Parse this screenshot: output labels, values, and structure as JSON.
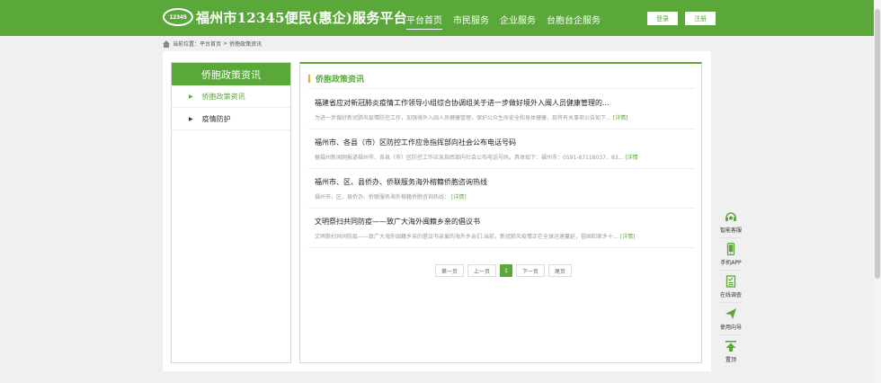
{
  "header": {
    "logo_text": "12345",
    "site_title": "福州市12345便民(惠企)服务平台",
    "nav": [
      "平台首页",
      "市民服务",
      "企业服务",
      "台胞台企服务"
    ],
    "login_label": "登录",
    "register_label": "注册"
  },
  "breadcrumb": {
    "prefix": "当前位置：",
    "home": "平台首页",
    "separator": ">",
    "current": "侨胞政策资讯"
  },
  "sidebar": {
    "title": "侨胞政策资讯",
    "items": [
      {
        "label": "侨胞政策资讯",
        "bullet": "▶"
      },
      {
        "label": "疫情防护",
        "bullet": "▶"
      }
    ]
  },
  "content": {
    "title": "侨胞政策资讯",
    "articles": [
      {
        "title": "福建省应对新冠肺炎疫情工作领导小组综合协调组关于进一步做好境外入闽人员健康管理的...",
        "summary": "为进一步做好新冠肺炎疫情防控工作，加强境外入闽人员健康管理，保护公众生命安全和身体健康，现将有关事项公告如下...",
        "detail": "[详情]"
      },
      {
        "title": "福州市、各县（市）区防控工作应急指挥部向社会公布电话号码",
        "summary": "据福州新闻网报道福州市、各县（市）区防控工作应急指挥部向社会公布电话号码，具体如下：福州市：0591-87118037、83...",
        "detail": "[详情"
      },
      {
        "title": "福州市、区、县侨办、侨联服务海外榕籍侨胞咨询热线",
        "summary": "福州市、区、县侨办、侨联服务海外榕籍侨胞咨询热线：",
        "detail": "[详情]"
      },
      {
        "title": "文明祭扫共同防疫——致广大海外闽籍乡亲的倡议书",
        "summary": "文明祭扫共同防疫——致广大海外闽籍乡亲的倡议书亲爱的海外乡亲们:当前，新冠肺炎疫情正在全球迅速蔓延，祖国和家乡十...",
        "detail": "[详情]"
      }
    ]
  },
  "pagination": {
    "first": "第一页",
    "prev": "上一页",
    "current": "1",
    "next": "下一页",
    "last": "尾页"
  },
  "float_bar": [
    {
      "label": "智能客服",
      "icon": "headset-icon"
    },
    {
      "label": "手机APP",
      "icon": "phone-icon"
    },
    {
      "label": "在线调查",
      "icon": "survey-icon"
    },
    {
      "label": "使用向导",
      "icon": "paper-plane-icon"
    },
    {
      "label": "置顶",
      "icon": "arrow-up-top-icon"
    }
  ],
  "colors": {
    "brand_green": "#5aa83a",
    "accent_yellow": "#e3b12a"
  }
}
